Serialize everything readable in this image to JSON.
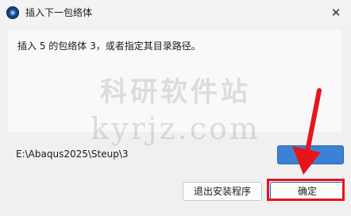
{
  "window": {
    "title": "插入下一包络体",
    "close_glyph": "✕"
  },
  "message": "插入 5 的包络体 3，或者指定其目录路径。",
  "path_field": {
    "value": "E:\\Abaqus2025\\Steup\\3"
  },
  "browse_button": {
    "label": "..."
  },
  "buttons": {
    "exit_label": "退出安装程序",
    "ok_label": "确定"
  },
  "watermark": {
    "cn": "科研软件站",
    "en": "kyrjz.com"
  },
  "annotation": {
    "color": "#e8141c"
  }
}
